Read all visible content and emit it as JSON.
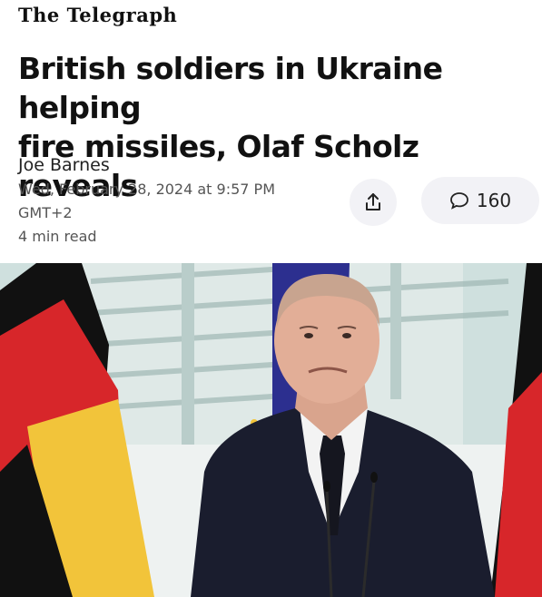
{
  "masthead": "The Telegraph",
  "headline": {
    "line1": "British soldiers in Ukraine helping",
    "line2": "fire missiles, Olaf Scholz reveals"
  },
  "byline": {
    "author": "Joe Barnes",
    "date": "Wed, February 28, 2024 at 9:57 PM",
    "timezone": "GMT+2",
    "read_time": "4 min read"
  },
  "actions": {
    "share_icon": "share-icon",
    "comment_icon": "comment-bubble-icon",
    "comment_count": "160"
  },
  "photo": {
    "description_colors": {
      "flag_black": "#111111",
      "flag_red": "#d7262a",
      "flag_gold": "#f2c43a",
      "eu_blue": "#2c2f8f",
      "background": "#cfe0de"
    }
  }
}
